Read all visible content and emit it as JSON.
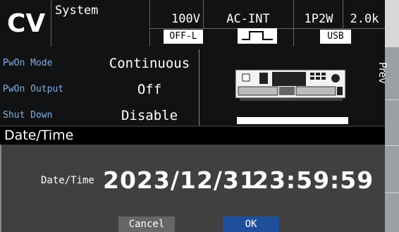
{
  "header": {
    "mode": "CV",
    "screen": "System",
    "voltage_range": "100V",
    "source": "AC-INT",
    "wiring": "1P2W",
    "power": "2.0k",
    "output_state": "OFF-L",
    "waveform_icon": "sine-wave-icon",
    "interface": "USB"
  },
  "settings": [
    {
      "label": "PwOn Mode",
      "value": "Continuous"
    },
    {
      "label": "PwOn Output",
      "value": "Off"
    },
    {
      "label": "Shut Down",
      "value": "Disable"
    }
  ],
  "sidekeys": {
    "prev_label": "Prev"
  },
  "dialog": {
    "title": "Date/Time",
    "field_label": "Date/Time",
    "date": "2023/12/31",
    "time": "23:59:59",
    "cancel_label": "Cancel",
    "ok_label": "OK"
  },
  "colors": {
    "label_blue": "#7fb0e3",
    "ok_button": "#1f4f9a",
    "cancel_button": "#666666"
  }
}
